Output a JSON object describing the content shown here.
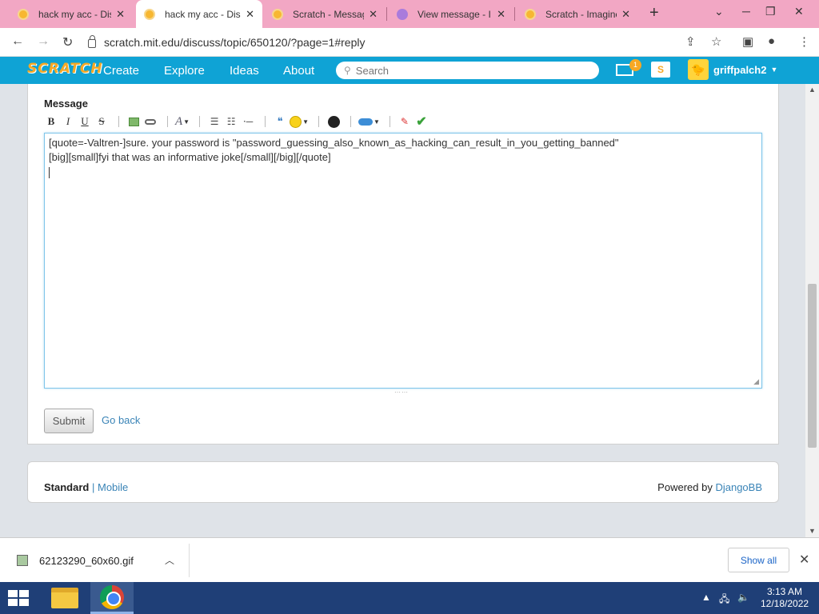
{
  "browser": {
    "tabs": [
      {
        "title": "hack my acc - Dis",
        "active": false
      },
      {
        "title": "hack my acc - Dis",
        "active": true
      },
      {
        "title": "Scratch - Messag",
        "active": false
      },
      {
        "title": "View message - I",
        "active": false
      },
      {
        "title": "Scratch - Imagine",
        "active": false
      }
    ],
    "url": "scratch.mit.edu/discuss/topic/650120/?page=1#reply"
  },
  "scratch_nav": {
    "logo": "SCRATCH",
    "links": [
      "Create",
      "Explore",
      "Ideas",
      "About"
    ],
    "search_placeholder": "Search",
    "message_count": "1",
    "username": "griffpalch2"
  },
  "form": {
    "label": "Message",
    "text_lines": [
      "[quote=-Valtren-]sure. your password is \"password_guessing_also_known_as_hacking_can_result_in_you_getting_banned\"",
      "[big][small]fyi that was an informative joke[/small][/big][/quote]"
    ],
    "submit_label": "Submit",
    "goback_label": "Go back"
  },
  "footer": {
    "standard": "Standard",
    "separator": "|",
    "mobile": "Mobile",
    "powered_by": "Powered by",
    "engine": "DjangoBB"
  },
  "download": {
    "filename": "62123290_60x60.gif",
    "show_all": "Show all"
  },
  "taskbar": {
    "time": "3:13 AM",
    "date": "12/18/2022"
  }
}
